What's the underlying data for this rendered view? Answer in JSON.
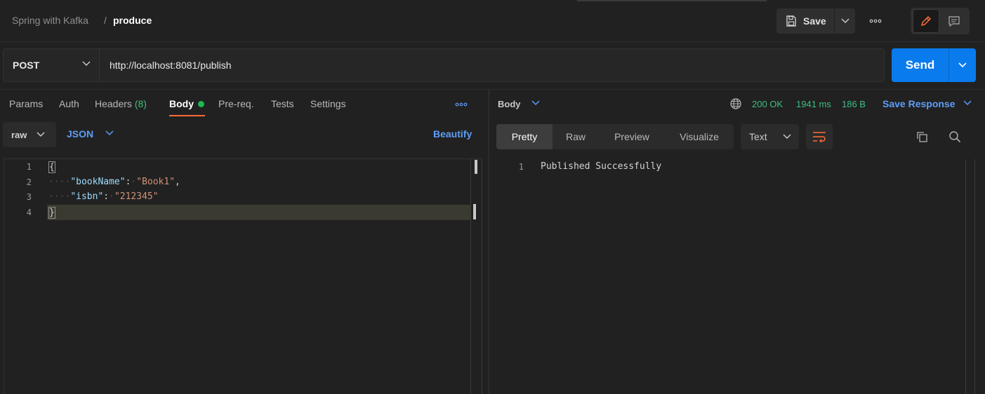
{
  "breadcrumb": {
    "parent": "Spring with Kafka",
    "separator": "/",
    "current": "produce"
  },
  "toolbar": {
    "save_label": "Save",
    "more_icon": "ellipsis-icon"
  },
  "request": {
    "method": "POST",
    "url": "http://localhost:8081/publish",
    "send_label": "Send"
  },
  "request_tabs": {
    "params": "Params",
    "auth": "Auth",
    "headers": "Headers",
    "headers_count": "(8)",
    "body": "Body",
    "prereq": "Pre-req.",
    "tests": "Tests",
    "settings": "Settings"
  },
  "body_options": {
    "mode": "raw",
    "language": "JSON",
    "beautify": "Beautify"
  },
  "editor": {
    "lines": [
      {
        "num": "1",
        "text": "{"
      },
      {
        "num": "2",
        "key": "\"bookName\"",
        "value": "\"Book1\""
      },
      {
        "num": "3",
        "key": "\"isbn\"",
        "value": "\"212345\""
      },
      {
        "num": "4",
        "text": "}"
      }
    ]
  },
  "response": {
    "section_label": "Body",
    "status": "200 OK",
    "time": "1941 ms",
    "size": "186 B",
    "save_response": "Save Response",
    "tabs": {
      "pretty": "Pretty",
      "raw": "Raw",
      "preview": "Preview",
      "visualize": "Visualize"
    },
    "format": "Text",
    "lines": [
      {
        "num": "1",
        "text": "Published Successfully"
      }
    ]
  },
  "colors": {
    "accent": "#097bed",
    "active_tab": "#ff6c37",
    "success": "#3fbf7f",
    "link": "#5e9df5"
  }
}
